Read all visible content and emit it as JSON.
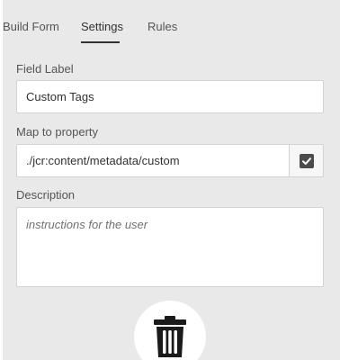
{
  "tabs": [
    {
      "label": "Build Form"
    },
    {
      "label": "Settings"
    },
    {
      "label": "Rules"
    }
  ],
  "active_tab": "Settings",
  "fields": {
    "field_label": {
      "label": "Field Label",
      "value": "Custom Tags"
    },
    "map_to_property": {
      "label": "Map to property",
      "value": "./jcr:content/metadata/custom",
      "button_icon": "checkbox-checked-icon"
    },
    "description": {
      "label": "Description",
      "placeholder": "instructions for the user",
      "value": ""
    }
  },
  "actions": {
    "delete_icon": "trash-icon"
  },
  "colors": {
    "panel_bg": "#e9e9e9",
    "active_tab_underline": "#323232",
    "checkbox": "#4b4b4b",
    "trash": "#1a1a1a"
  }
}
